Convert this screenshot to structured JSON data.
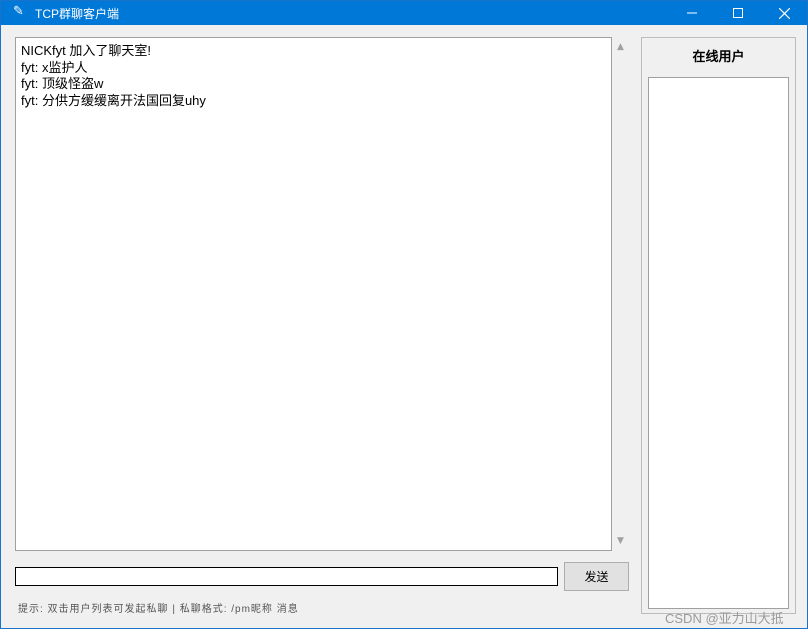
{
  "window": {
    "title": "TCP群聊客户端",
    "title_icon": "feather-icon"
  },
  "chat": {
    "lines": [
      "NICKfyt 加入了聊天室!",
      "fyt: x监护人",
      "fyt: 顶级怪盗w",
      "fyt: 分供方缓缓离开法国回复uhy"
    ]
  },
  "input": {
    "value": "",
    "send_label": "发送"
  },
  "hint": "提示: 双击用户列表可发起私聊 | 私聊格式: /pm昵称 消息",
  "users": {
    "title": "在线用户",
    "items": []
  },
  "watermark": "CSDN @亚力山大抵",
  "colors": {
    "titlebar": "#0078d7",
    "window_bg": "#f0f0f0"
  }
}
